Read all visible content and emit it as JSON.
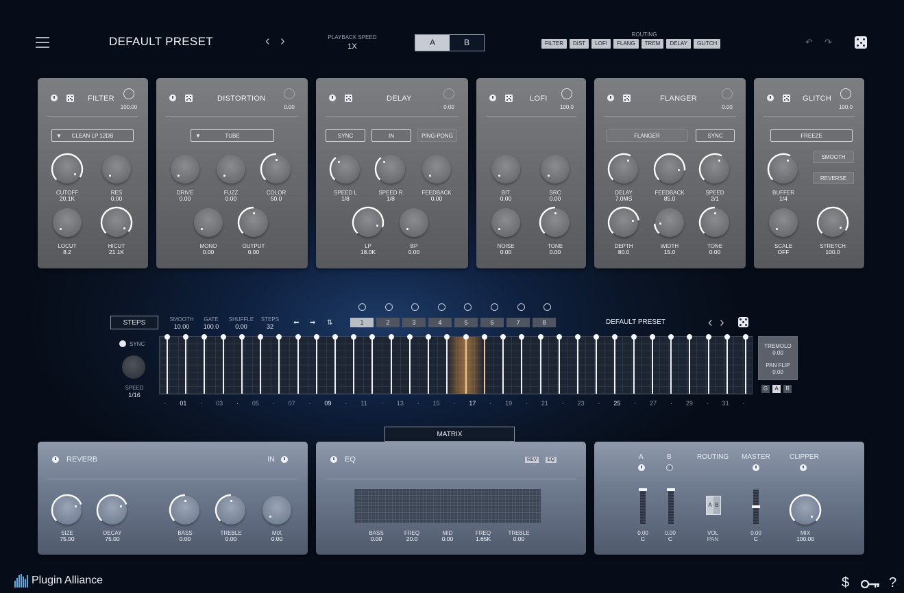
{
  "header": {
    "preset_name": "DEFAULT PRESET",
    "prev_arrow": "‹",
    "next_arrow": "›",
    "playback_speed_label": "PLAYBACK SPEED",
    "playback_speed_value": "1X",
    "ab": [
      "A",
      "B"
    ],
    "routing_label": "ROUTING",
    "routing": [
      "FILTER",
      "DIST",
      "LOFI",
      "FLANG",
      "TREM",
      "DELAY",
      "GLITCH"
    ],
    "undo": "↶",
    "redo": "↷"
  },
  "modules": {
    "filter": {
      "title": "FILTER",
      "top_value": "100.00",
      "mode": "CLEAN LP 12DB",
      "knobs": [
        {
          "name": "CUTOFF",
          "value": "20.1K"
        },
        {
          "name": "RES",
          "value": "0.00"
        },
        {
          "name": "LOCUT",
          "value": "8.2"
        },
        {
          "name": "HICUT",
          "value": "21.1K"
        }
      ]
    },
    "distortion": {
      "title": "DISTORTION",
      "top_value": "0.00",
      "mode": "TUBE",
      "knobs": [
        {
          "name": "DRIVE",
          "value": "0.00"
        },
        {
          "name": "FUZZ",
          "value": "0.00"
        },
        {
          "name": "COLOR",
          "value": "50.0"
        },
        {
          "name": "MONO",
          "value": "0.00"
        },
        {
          "name": "OUTPUT",
          "value": "0.00"
        }
      ]
    },
    "delay": {
      "title": "DELAY",
      "top_value": "0.00",
      "buttons": [
        "SYNC",
        "IN",
        "PING-PONG"
      ],
      "knobs": [
        {
          "name": "SPEED L",
          "value": "1/8"
        },
        {
          "name": "SPEED R",
          "value": "1/8"
        },
        {
          "name": "FEEDBACK",
          "value": "0.00"
        },
        {
          "name": "LP",
          "value": "18.0K"
        },
        {
          "name": "BP",
          "value": "0.00"
        }
      ]
    },
    "lofi": {
      "title": "LOFI",
      "top_value": "100.0",
      "knobs": [
        {
          "name": "BIT",
          "value": "0.00"
        },
        {
          "name": "SRC",
          "value": "0.00"
        },
        {
          "name": "NOISE",
          "value": "0.00"
        },
        {
          "name": "TONE",
          "value": "0.00"
        }
      ]
    },
    "flanger": {
      "title": "FLANGER",
      "top_value": "0.00",
      "buttons": [
        "FLANGER",
        "SYNC"
      ],
      "knobs": [
        {
          "name": "DELAY",
          "value": "7.0MS"
        },
        {
          "name": "FEEDBACK",
          "value": "85.0"
        },
        {
          "name": "SPEED",
          "value": "2/1"
        },
        {
          "name": "DEPTH",
          "value": "80.0"
        },
        {
          "name": "WIDTH",
          "value": "15.0"
        },
        {
          "name": "TONE",
          "value": "0.00"
        }
      ]
    },
    "glitch": {
      "title": "GLITCH",
      "top_value": "100.0",
      "buttons": [
        "FREEZE",
        "SMOOTH",
        "REVERSE"
      ],
      "knobs": [
        {
          "name": "BUFFER",
          "value": "1/4"
        },
        {
          "name": "SCALE",
          "value": "OFF"
        },
        {
          "name": "STRETCH",
          "value": "100.0"
        }
      ]
    }
  },
  "sequencer": {
    "steps_button": "STEPS",
    "params": [
      {
        "name": "SMOOTH",
        "value": "10.00"
      },
      {
        "name": "GATE",
        "value": "100.0"
      },
      {
        "name": "SHUFFLE",
        "value": "0.00"
      },
      {
        "name": "STEPS",
        "value": "32"
      }
    ],
    "controls": [
      "⬅",
      "➡",
      "⇅"
    ],
    "patterns": [
      "1",
      "2",
      "3",
      "4",
      "5",
      "6",
      "7",
      "8"
    ],
    "selected_pattern": "1",
    "preset_name": "DEFAULT PRESET",
    "sync_label": "SYNC",
    "speed_label": "SPEED",
    "speed_value": "1/16",
    "step_count": 32,
    "active_step": 17,
    "step_labels": [
      "·",
      "01",
      "·",
      "03",
      "·",
      "05",
      "·",
      "07",
      "·",
      "09",
      "·",
      "11",
      "·",
      "13",
      "·",
      "15",
      "·",
      "17",
      "·",
      "19",
      "·",
      "21",
      "·",
      "23",
      "·",
      "25",
      "·",
      "27",
      "·",
      "29",
      "·",
      "31",
      "·"
    ],
    "highlighted_labels": [
      "01",
      "09",
      "17",
      "25"
    ],
    "tremolo_label": "TREMOLO",
    "tremolo_value": "0.00",
    "panflip_label": "PAN FLIP",
    "panflip_value": "0.00",
    "gab": [
      "G",
      "A",
      "B"
    ],
    "gab_selected": "A"
  },
  "matrix_button": "MATRIX",
  "reverb": {
    "title": "REVERB",
    "in_label": "IN",
    "knobs": [
      {
        "name": "SIZE",
        "value": "75.00"
      },
      {
        "name": "DECAY",
        "value": "75.00"
      },
      {
        "name": "BASS",
        "value": "0.00"
      },
      {
        "name": "TREBLE",
        "value": "0.00"
      },
      {
        "name": "MIX",
        "value": "0.00"
      }
    ]
  },
  "eq": {
    "title": "EQ",
    "tags": [
      "REV",
      "EQ"
    ],
    "bands": [
      {
        "name": "BASS",
        "value": "0.00"
      },
      {
        "name": "FREQ",
        "value": "20.0"
      },
      {
        "name": "MID",
        "value": "0.00"
      },
      {
        "name": "FREQ",
        "value": "1.65K"
      },
      {
        "name": "TREBLE",
        "value": "0.00"
      }
    ]
  },
  "output": {
    "labels": [
      "A",
      "B",
      "ROUTING",
      "MASTER",
      "CLIPPER"
    ],
    "fader_a": {
      "value": "0.00",
      "pan": "C"
    },
    "fader_b": {
      "value": "0.00",
      "pan": "C"
    },
    "vol_label": "VOL",
    "pan_label": "PAN",
    "ab_block": [
      "A",
      "B"
    ],
    "master": {
      "value": "0.00",
      "pan": "C"
    },
    "mix_label": "MIX",
    "mix_value": "100.00"
  },
  "footer": {
    "brand": "Plugin Alliance",
    "icons": [
      "$",
      "key-icon",
      "?"
    ]
  }
}
